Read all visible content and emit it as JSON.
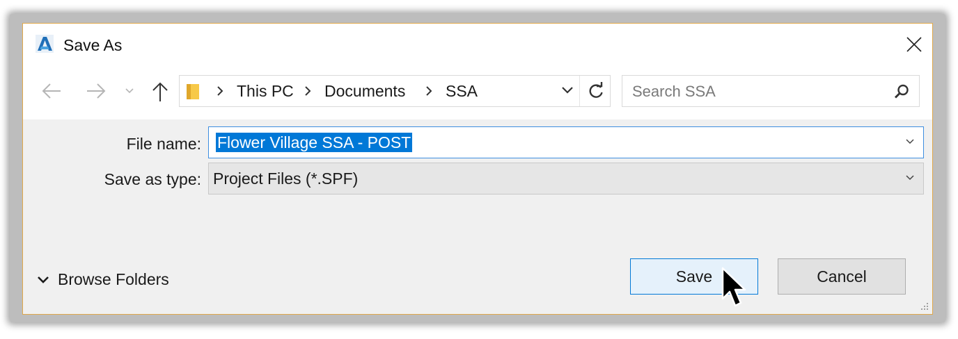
{
  "window": {
    "title": "Save As",
    "app_icon": "autodesk-a-icon",
    "close_icon": "close-icon"
  },
  "nav": {
    "back_icon": "back-arrow-icon",
    "forward_icon": "forward-arrow-icon",
    "recent_icon": "chevron-down-icon",
    "up_icon": "up-arrow-icon",
    "breadcrumb": [
      "This PC",
      "Documents",
      "SSA"
    ],
    "refresh_icon": "refresh-icon"
  },
  "search": {
    "placeholder": "Search SSA",
    "value": "",
    "icon": "search-icon"
  },
  "form": {
    "file_name_label": "File name:",
    "file_name_value": "Flower Village SSA - POST",
    "save_type_label": "Save as type:",
    "save_type_value": "Project Files (*.SPF)"
  },
  "footer": {
    "browse_folders_label": "Browse Folders",
    "save_label": "Save",
    "cancel_label": "Cancel"
  },
  "colors": {
    "accent": "#0078d7",
    "frame_border": "#e0a84a",
    "dialog_bg": "#f0f0f0"
  }
}
